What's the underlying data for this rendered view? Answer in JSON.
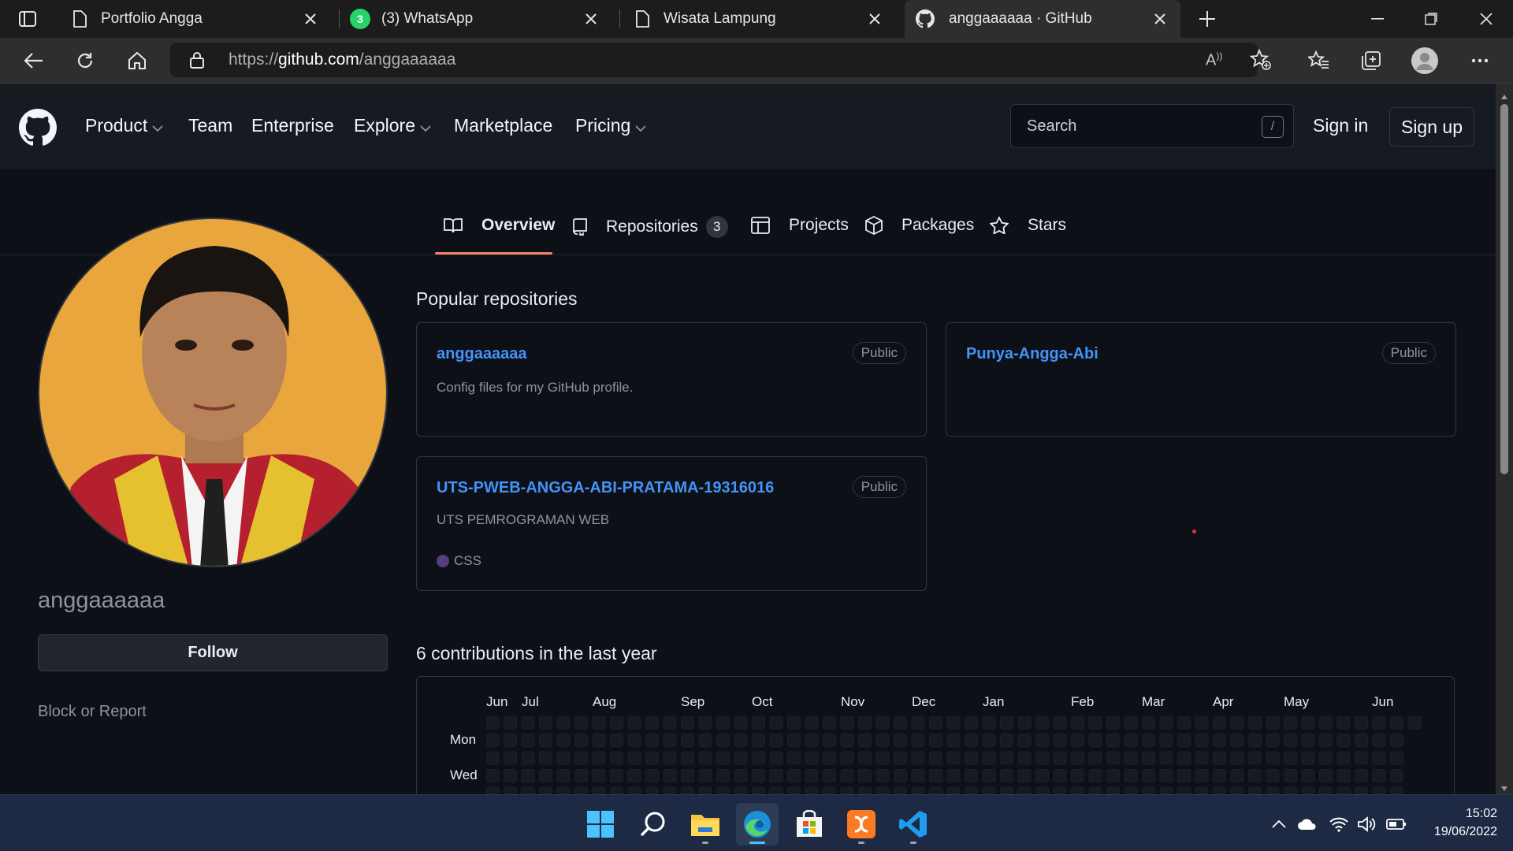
{
  "browser": {
    "tabs": [
      {
        "title": "Portfolio Angga",
        "icon": "page-icon",
        "active": false
      },
      {
        "title": "(3) WhatsApp",
        "icon": "whatsapp-icon",
        "badge": "3",
        "active": false
      },
      {
        "title": "Wisata Lampung",
        "icon": "page-icon",
        "active": false
      },
      {
        "title": "anggaaaaaa · GitHub",
        "icon": "github-icon",
        "active": true
      }
    ],
    "url_prefix": "https://",
    "url_domain": "github.com",
    "url_path": "/anggaaaaaa"
  },
  "header": {
    "nav": [
      "Product",
      "Team",
      "Enterprise",
      "Explore",
      "Marketplace",
      "Pricing"
    ],
    "search_placeholder": "Search",
    "search_shortcut": "/",
    "sign_in": "Sign in",
    "sign_up": "Sign up"
  },
  "profile_nav": {
    "overview": "Overview",
    "repositories": "Repositories",
    "repositories_count": "3",
    "projects": "Projects",
    "packages": "Packages",
    "stars": "Stars"
  },
  "profile": {
    "username": "anggaaaaaa",
    "follow_label": "Follow",
    "block_label": "Block or Report"
  },
  "repos": {
    "section_title": "Popular repositories",
    "items": [
      {
        "name": "anggaaaaaa",
        "visibility": "Public",
        "description": "Config files for my GitHub profile.",
        "language": ""
      },
      {
        "name": "Punya-Angga-Abi",
        "visibility": "Public",
        "description": "",
        "language": ""
      },
      {
        "name": "UTS-PWEB-ANGGA-ABI-PRATAMA-19316016",
        "visibility": "Public",
        "description": "UTS PEMROGRAMAN WEB",
        "language": "CSS",
        "language_color": "#563d7c"
      }
    ]
  },
  "contributions": {
    "title": "6 contributions in the last year",
    "months": [
      "Jun",
      "Jul",
      "Aug",
      "Sep",
      "Oct",
      "Nov",
      "Dec",
      "Jan",
      "Feb",
      "Mar",
      "Apr",
      "May",
      "Jun"
    ],
    "weekdays": [
      "Mon",
      "Wed"
    ],
    "empty_color": "#161b22"
  },
  "taskbar": {
    "apps": [
      "start-icon",
      "search-icon",
      "file-explorer-icon",
      "edge-icon",
      "store-icon",
      "xampp-icon",
      "vscode-icon"
    ],
    "time": "15:02",
    "date": "19/06/2022"
  },
  "colors": {
    "accent_link": "#4493f8",
    "tab_underline": "#f78166",
    "bg": "#0d1117",
    "header_bg": "#161b22"
  }
}
